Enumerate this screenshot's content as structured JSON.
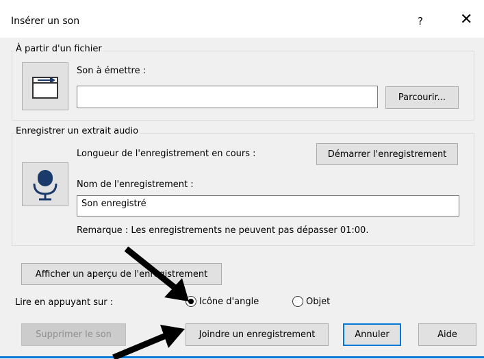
{
  "window": {
    "title": "Insérer un son",
    "help_label": "?",
    "close_label": "✕"
  },
  "file_group": {
    "legend": "À partir d'un fichier",
    "sound_label": "Son à émettre :",
    "sound_value": "",
    "browse_label": "Parcourir..."
  },
  "record_group": {
    "legend": "Enregistrer un extrait audio",
    "length_label": "Longueur de l'enregistrement en cours :",
    "start_label": "Démarrer l'enregistrement",
    "name_label": "Nom de l'enregistrement :",
    "name_value": "Son enregistré",
    "note": "Remarque : Les enregistrements ne peuvent pas dépasser 01:00."
  },
  "preview_label": "Afficher un aperçu de l'enregistrement",
  "play_on": {
    "label": "Lire en appuyant sur :",
    "options": [
      {
        "label": "Icône d'angle",
        "selected": true
      },
      {
        "label": "Objet",
        "selected": false
      }
    ]
  },
  "buttons": {
    "delete_label": "Supprimer le son",
    "attach_label": "Joindre un enregistrement",
    "cancel_label": "Annuler",
    "help_label": "Aide"
  },
  "colors": {
    "accent": "#0078d7",
    "panel": "#f0f0f0"
  }
}
